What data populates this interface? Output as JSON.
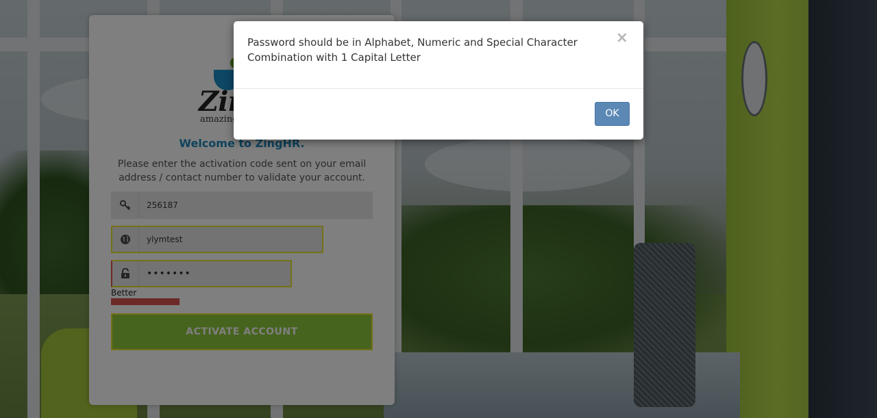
{
  "login": {
    "welcome": "Welcome to ZingHR.",
    "info": "Please enter the activation code sent on your email address / contact number to validate your account.",
    "logo_word": "ZingHR",
    "logo_tagline": "amazing",
    "activation_code_value": "256187",
    "username_value": "ylymtest",
    "password_value": "•••••••",
    "password_strength_label": "Better",
    "activate_label": "ACTIVATE ACCOUNT",
    "colors": {
      "welcome": "#1f86b8",
      "activate_bg": "#8fc93f",
      "highlight_border": "#e8e22a",
      "strength_bar": "#d9534f"
    }
  },
  "modal": {
    "message": "Password should be in Alphabet, Numeric and Special Character Combination with 1 Capital Letter",
    "close_symbol": "×",
    "ok_label": "OK",
    "colors": {
      "ok_bg": "#5b88b5"
    }
  },
  "icons": {
    "code_field": "key-icon",
    "username_field": "globe-icon",
    "password_field": "lock-icon",
    "modal_close": "close-icon"
  }
}
